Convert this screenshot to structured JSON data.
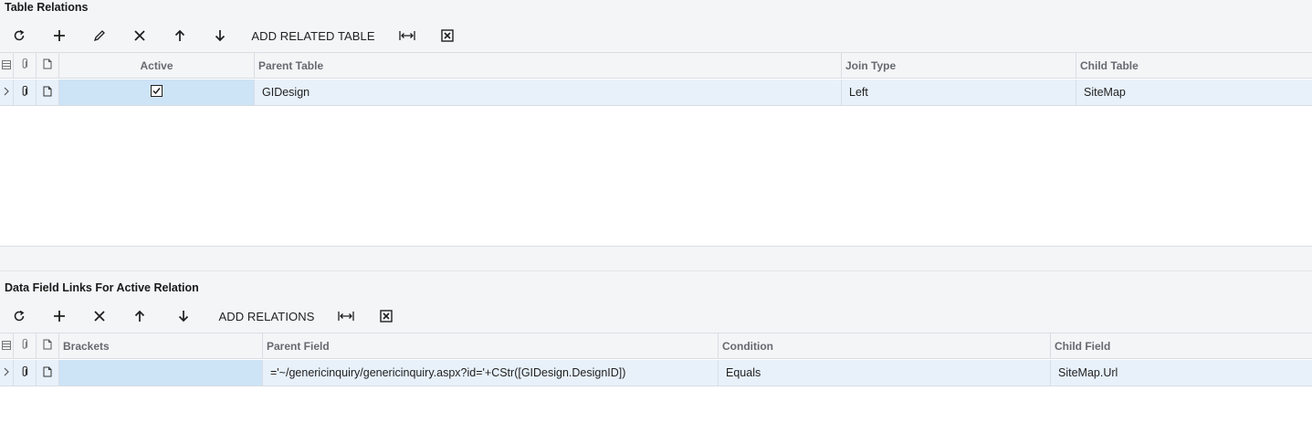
{
  "relations": {
    "title": "Table Relations",
    "toolbar": {
      "refresh": "refresh-icon",
      "add": "plus-icon",
      "edit": "pencil-icon",
      "delete": "x-icon",
      "up": "arrow-up-icon",
      "down": "arrow-down-icon",
      "add_related_label": "ADD RELATED TABLE",
      "fit": "fit-columns-icon",
      "export": "excel-icon"
    },
    "columns": [
      "Active",
      "Parent Table",
      "Join Type",
      "Child Table"
    ],
    "rows": [
      {
        "active": true,
        "parent_table": "GIDesign",
        "join_type": "Left",
        "child_table": "SiteMap"
      }
    ]
  },
  "links": {
    "title": "Data Field Links For Active Relation",
    "toolbar": {
      "refresh": "refresh-icon",
      "add": "plus-icon",
      "delete": "x-icon",
      "up": "arrow-up-icon",
      "down": "arrow-down-icon",
      "add_relations_label": "ADD RELATIONS",
      "fit": "fit-columns-icon",
      "export": "excel-icon"
    },
    "columns": [
      "Brackets",
      "Parent Field",
      "Condition",
      "Child Field"
    ],
    "rows": [
      {
        "brackets": "",
        "parent_field": "='~/genericinquiry/genericinquiry.aspx?id='+CStr([GIDesign.DesignID])",
        "condition": "Equals",
        "child_field": "SiteMap.Url"
      }
    ]
  },
  "colors": {
    "header_bg": "#f4f5f7",
    "row_bg": "#e8f1fa",
    "selected_cell": "#cde3f6",
    "border": "#d9dde3"
  }
}
